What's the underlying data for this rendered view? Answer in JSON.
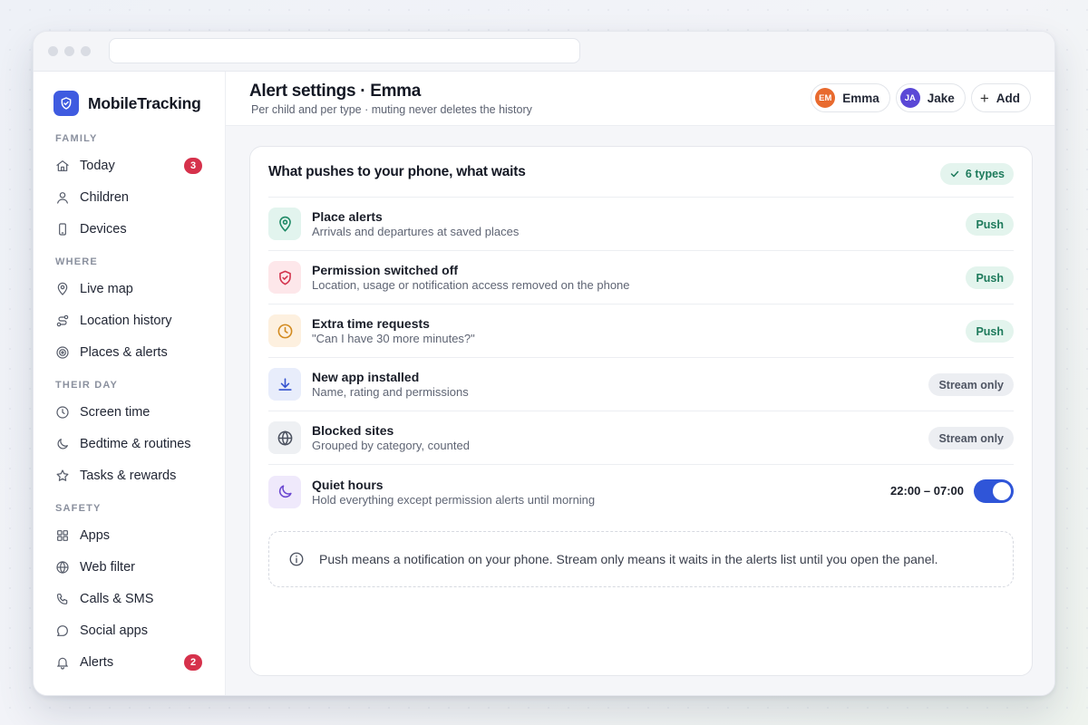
{
  "brand": {
    "name": "MobileTracking"
  },
  "sidebar": {
    "sections": [
      {
        "label": "FAMILY",
        "items": [
          {
            "label": "Today",
            "icon": "home-icon",
            "badge": "3"
          },
          {
            "label": "Children",
            "icon": "user-icon"
          },
          {
            "label": "Devices",
            "icon": "phone-icon"
          }
        ]
      },
      {
        "label": "WHERE",
        "items": [
          {
            "label": "Live map",
            "icon": "map-pin-icon"
          },
          {
            "label": "Location history",
            "icon": "route-icon"
          },
          {
            "label": "Places & alerts",
            "icon": "target-icon"
          }
        ]
      },
      {
        "label": "THEIR DAY",
        "items": [
          {
            "label": "Screen time",
            "icon": "clock-icon"
          },
          {
            "label": "Bedtime & routines",
            "icon": "moon-icon"
          },
          {
            "label": "Tasks & rewards",
            "icon": "star-icon"
          }
        ]
      },
      {
        "label": "SAFETY",
        "items": [
          {
            "label": "Apps",
            "icon": "grid-icon"
          },
          {
            "label": "Web filter",
            "icon": "globe-icon"
          },
          {
            "label": "Calls & SMS",
            "icon": "phone-call-icon"
          },
          {
            "label": "Social apps",
            "icon": "chat-icon"
          },
          {
            "label": "Alerts",
            "icon": "bell-icon",
            "badge": "2"
          }
        ]
      }
    ]
  },
  "header": {
    "title": "Alert settings · Emma",
    "subtitle": "Per child and per type · muting never deletes the history",
    "children": [
      {
        "initials": "EM",
        "name": "Emma",
        "color": "#e86a2e"
      },
      {
        "initials": "JA",
        "name": "Jake",
        "color": "#5b48d6"
      }
    ],
    "add_label": "Add"
  },
  "card": {
    "title": "What pushes to your phone, what waits",
    "count_label": "6 types",
    "rows": [
      {
        "title": "Place alerts",
        "desc": "Arrivals and departures at saved places",
        "icon": "map-pin-icon",
        "mode": "Push"
      },
      {
        "title": "Permission switched off",
        "desc": "Location, usage or notification access removed on the phone",
        "icon": "shield-alert-icon",
        "mode": "Push"
      },
      {
        "title": "Extra time requests",
        "desc": "\"Can I have 30 more minutes?\"",
        "icon": "clock-icon",
        "mode": "Push"
      },
      {
        "title": "New app installed",
        "desc": "Name, rating and permissions",
        "icon": "download-icon",
        "mode": "Stream only"
      },
      {
        "title": "Blocked sites",
        "desc": "Grouped by category, counted",
        "icon": "globe-icon",
        "mode": "Stream only"
      }
    ],
    "quiet": {
      "title": "Quiet hours",
      "desc": "Hold everything except permission alerts until morning",
      "time": "22:00 – 07:00",
      "enabled": true
    },
    "note": "Push means a notification on your phone. Stream only means it waits in the alerts list until you open the panel."
  },
  "colors": {
    "accent": "#2f55d8",
    "badge": "#d6314b",
    "push": "#1d7a5b"
  }
}
